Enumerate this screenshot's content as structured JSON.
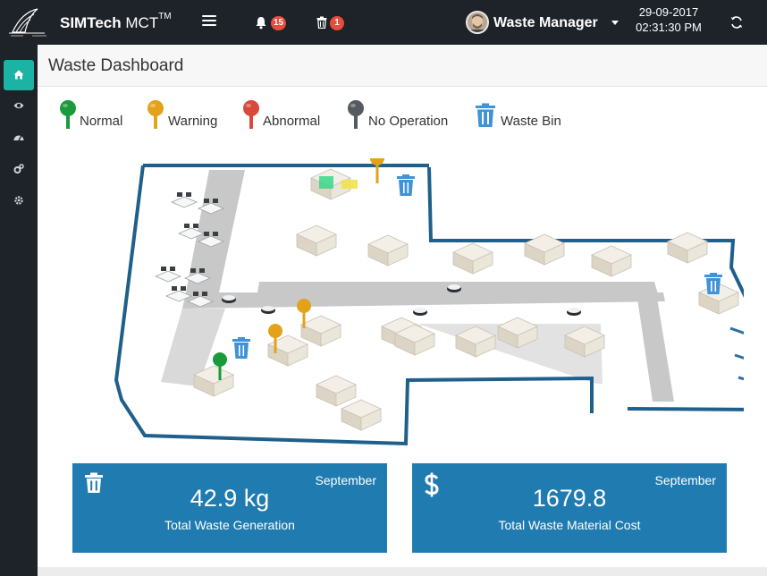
{
  "app": {
    "brand_bold": "SIMTech",
    "brand_light": "MCT",
    "brand_sup": "TM"
  },
  "header": {
    "notifications_count": "15",
    "waste_alerts_count": "1",
    "user_name": "Waste Manager",
    "date": "29-09-2017",
    "time": "02:31:30 PM"
  },
  "sidebar": {
    "items": [
      {
        "icon": "home-icon",
        "active": true
      },
      {
        "icon": "eye-icon",
        "active": false
      },
      {
        "icon": "dashboard-gauge-icon",
        "active": false
      },
      {
        "icon": "cogs-icon",
        "active": false
      },
      {
        "icon": "gear-icon",
        "active": false
      }
    ]
  },
  "page": {
    "title": "Waste Dashboard"
  },
  "legend": {
    "items": [
      {
        "label": "Normal",
        "color": "#1a9a3a",
        "icon": "map-pin-icon"
      },
      {
        "label": "Warning",
        "color": "#e3a21a",
        "icon": "map-pin-icon"
      },
      {
        "label": "Abnormal",
        "color": "#d9483b",
        "icon": "map-pin-icon"
      },
      {
        "label": "No Operation",
        "color": "#555a5e",
        "icon": "map-pin-icon"
      },
      {
        "label": "Waste Bin",
        "color": "#3f93d6",
        "icon": "trash-icon"
      }
    ]
  },
  "cards": {
    "waste": {
      "month": "September",
      "value": "42.9 kg",
      "caption": "Total Waste Generation",
      "icon": "trash-icon"
    },
    "cost": {
      "month": "September",
      "value": "1679.8",
      "caption": "Total Waste Material Cost",
      "icon": "dollar-icon"
    }
  },
  "colors": {
    "topbar": "#1e2229",
    "accent": "#1bb3a3",
    "card": "#1f7bb0",
    "badge": "#e74c3c",
    "wall": "#1f5f8b"
  }
}
